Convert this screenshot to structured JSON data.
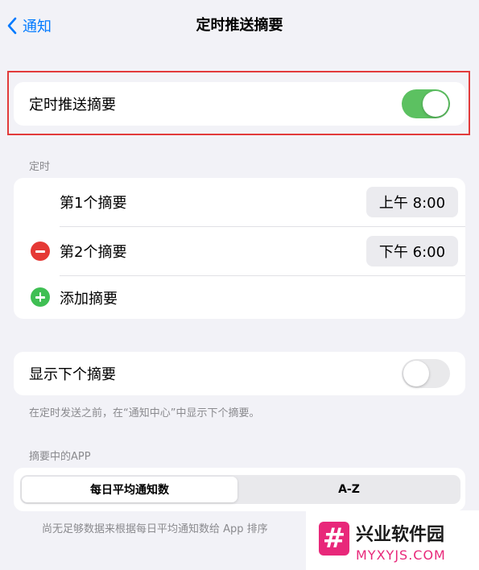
{
  "nav": {
    "back_label": "通知",
    "title": "定时推送摘要"
  },
  "main_toggle": {
    "label": "定时推送摘要",
    "state": "on"
  },
  "schedule": {
    "header": "定时",
    "items": [
      {
        "label": "第1个摘要",
        "time": "上午 8:00"
      },
      {
        "label": "第2个摘要",
        "time": "下午 6:00"
      }
    ],
    "add_label": "添加摘要"
  },
  "next_summary": {
    "label": "显示下个摘要",
    "state": "off",
    "footnote": "在定时发送之前，在“通知中心”中显示下个摘要。"
  },
  "apps": {
    "header": "摘要中的APP",
    "segments": [
      "每日平均通知数",
      "A-Z"
    ],
    "selected": "每日平均通知数",
    "footnote": "尚无足够数据来根据每日平均通知数给 App 排序"
  },
  "watermark": {
    "name": "兴业软件园",
    "url": "MYXYJS.COM"
  },
  "colors": {
    "accent": "#007aff",
    "toggle_on": "#5cc161",
    "highlight": "#e23b3b",
    "remove": "#e53935",
    "add": "#3fbf53"
  }
}
